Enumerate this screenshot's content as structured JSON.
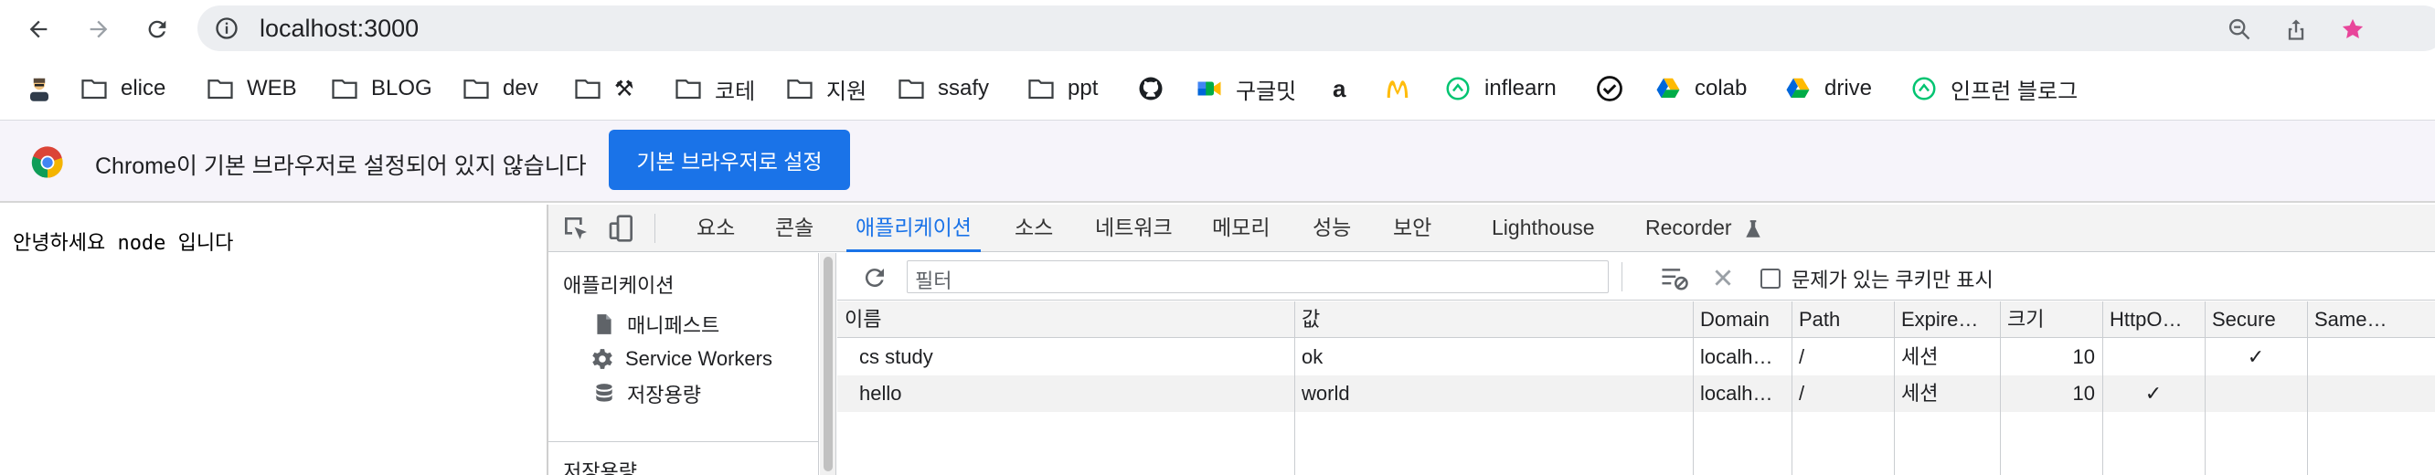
{
  "browser": {
    "url": "localhost:3000",
    "nav": {
      "back": "arrow-left-icon",
      "forward": "arrow-right-icon",
      "reload": "reload-icon"
    },
    "omnibox_icons": [
      "zoom-out-icon",
      "share-icon",
      "star-icon"
    ],
    "star_color": "#e8459a"
  },
  "bookmarks": [
    {
      "icon": "avatar-icon",
      "label": ""
    },
    {
      "icon": "folder-icon",
      "label": "elice"
    },
    {
      "icon": "folder-icon",
      "label": "WEB"
    },
    {
      "icon": "folder-icon",
      "label": "BLOG"
    },
    {
      "icon": "folder-icon",
      "label": "dev"
    },
    {
      "icon": "folder-icon",
      "label": "⚒"
    },
    {
      "icon": "folder-icon",
      "label": "코테"
    },
    {
      "icon": "folder-icon",
      "label": "지원"
    },
    {
      "icon": "folder-icon",
      "label": "ssafy"
    },
    {
      "icon": "folder-icon",
      "label": "ppt"
    },
    {
      "icon": "github-icon",
      "label": ""
    },
    {
      "icon": "meet-icon",
      "label": "구글밋"
    },
    {
      "icon": "amazon-icon",
      "label": "a"
    },
    {
      "icon": "mcdonalds-icon",
      "label": ""
    },
    {
      "icon": "inflearn-icon",
      "label": "inflearn"
    },
    {
      "icon": "check-circle-icon",
      "label": ""
    },
    {
      "icon": "drive-icon",
      "label": "colab"
    },
    {
      "icon": "drive-icon",
      "label": "drive"
    },
    {
      "icon": "inflearn-icon",
      "label": "인프런 블로그"
    }
  ],
  "infobar": {
    "message": "Chrome이 기본 브라우저로 설정되어 있지 않습니다",
    "button": "기본 브라우저로 설정"
  },
  "page": {
    "text": "안녕하세요 node 입니다"
  },
  "devtools": {
    "tabs": [
      "요소",
      "콘솔",
      "애플리케이션",
      "소스",
      "네트워크",
      "메모리",
      "성능",
      "보안",
      "Lighthouse",
      "Recorder"
    ],
    "active_tab": "애플리케이션",
    "sidebar": {
      "section": "애플리케이션",
      "items": [
        {
          "icon": "file-icon",
          "label": "매니페스트"
        },
        {
          "icon": "gear-icon",
          "label": "Service Workers"
        },
        {
          "icon": "database-icon",
          "label": "저장용량"
        }
      ],
      "section2": "저장용량"
    },
    "cookies": {
      "filter_placeholder": "필터",
      "only_issues_label": "문제가 있는 쿠키만 표시",
      "columns": [
        "이름",
        "값",
        "Domain",
        "Path",
        "Expire…",
        "크기",
        "HttpO…",
        "Secure",
        "Same…"
      ],
      "rows": [
        {
          "name": "cs study",
          "value": "ok",
          "domain": "localh…",
          "path": "/",
          "expires": "세션",
          "size": "10",
          "httponly": "",
          "secure": "✓",
          "samesite": ""
        },
        {
          "name": "hello",
          "value": "world",
          "domain": "localh…",
          "path": "/",
          "expires": "세션",
          "size": "10",
          "httponly": "✓",
          "secure": "",
          "samesite": ""
        }
      ]
    }
  }
}
